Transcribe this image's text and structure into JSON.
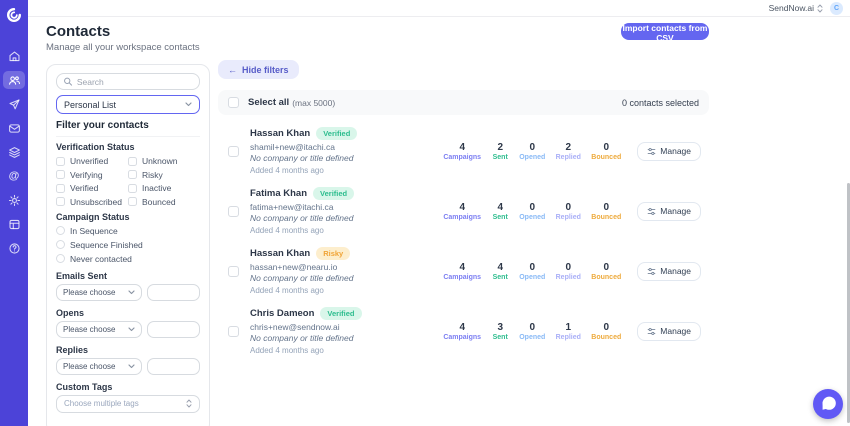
{
  "topbar": {
    "workspace": "SendNow.ai",
    "avatar_initial": "C"
  },
  "page": {
    "title": "Contacts",
    "subtitle": "Manage all your workspace contacts",
    "import_button": "Import contacts from CSV"
  },
  "icons": {
    "back_arrow": "←"
  },
  "colors": {
    "sidebar": "#4c43d8",
    "accent": "#6466f0",
    "verified_badge_bg": "#d9f6ea",
    "verified_badge_text": "#2dbd8e",
    "risky_badge_bg": "#fdeecd",
    "risky_badge_text": "#f0a437",
    "campaigns_label": "#7c7ff2",
    "sent_label": "#2dbd8e",
    "opened_label": "#8abaf6",
    "replied_label": "#a9aff7",
    "bounced_label": "#eeaa3c"
  },
  "filter_panel": {
    "search_placeholder": "Search",
    "list_value": "Personal List",
    "heading": "Filter your contacts",
    "verification_label": "Verification Status",
    "verification_options": [
      "Unverified",
      "Unknown",
      "Verifying",
      "Risky",
      "Verified",
      "Inactive",
      "Unsubscribed",
      "Bounced"
    ],
    "campaign_label": "Campaign Status",
    "campaign_options": [
      "In Sequence",
      "Sequence Finished",
      "Never contacted"
    ],
    "emails_sent_label": "Emails Sent",
    "opens_label": "Opens",
    "replies_label": "Replies",
    "choose_placeholder": "Please choose",
    "custom_tags_label": "Custom Tags",
    "custom_tags_placeholder": "Choose multiple tags"
  },
  "toolbar": {
    "hide_filters": "Hide filters",
    "select_all": "Select all",
    "select_all_hint": "(max 5000)",
    "selected_count": "0 contacts selected"
  },
  "stat_labels": {
    "campaigns": "Campaigns",
    "sent": "Sent",
    "opened": "Opened",
    "replied": "Replied",
    "bounced": "Bounced"
  },
  "manage_label": "Manage",
  "contacts": [
    {
      "name": "Hassan Khan",
      "badge": "Verified",
      "email": "shamil+new@itachi.ca",
      "company": "No company or title defined",
      "added": "Added 4 months ago",
      "campaigns": "4",
      "sent": "2",
      "opened": "0",
      "replied": "2",
      "bounced": "0"
    },
    {
      "name": "Fatima Khan",
      "badge": "Verified",
      "email": "fatima+new@itachi.ca",
      "company": "No company or title defined",
      "added": "Added 4 months ago",
      "campaigns": "4",
      "sent": "4",
      "opened": "0",
      "replied": "0",
      "bounced": "0"
    },
    {
      "name": "Hassan Khan",
      "badge": "Risky",
      "email": "hassan+new@nearu.io",
      "company": "No company or title defined",
      "added": "Added 4 months ago",
      "campaigns": "4",
      "sent": "4",
      "opened": "0",
      "replied": "0",
      "bounced": "0"
    },
    {
      "name": "Chris Dameon",
      "badge": "Verified",
      "email": "chris+new@sendnow.ai",
      "company": "No company or title defined",
      "added": "Added 4 months ago",
      "campaigns": "4",
      "sent": "3",
      "opened": "0",
      "replied": "1",
      "bounced": "0"
    }
  ]
}
